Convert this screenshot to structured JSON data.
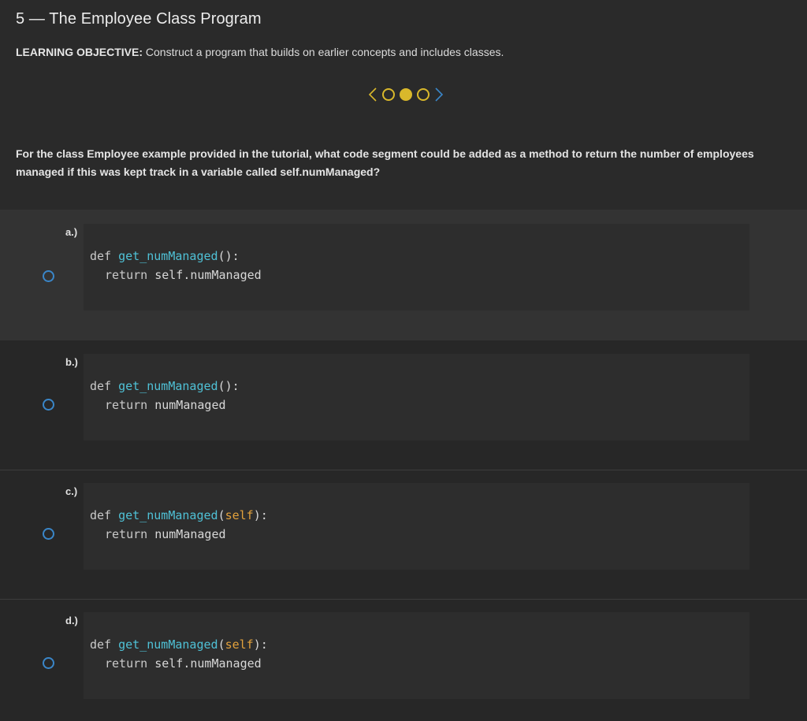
{
  "page": {
    "title": "5 — The Employee Class Program",
    "objective_label": "LEARNING OBJECTIVE:",
    "objective_text": " Construct a program that builds on earlier concepts and includes classes."
  },
  "pager": {
    "prev_icon": "chevron-left-icon",
    "next_icon": "chevron-right-icon",
    "dots": [
      "empty",
      "filled",
      "empty"
    ],
    "current": 2,
    "total": 3
  },
  "question": {
    "text": "For the class Employee example provided in the tutorial, what code segment could be added as a method to return the number of employees managed if this was kept track in a variable called self.numManaged?"
  },
  "options": [
    {
      "letter": "a.)",
      "line1": {
        "def": "def",
        "fn": "get_numManaged",
        "open": "(",
        "param": "",
        "close": "):"
      },
      "line2": {
        "kw": "return",
        "rest": " self.numManaged"
      }
    },
    {
      "letter": "b.)",
      "line1": {
        "def": "def",
        "fn": "get_numManaged",
        "open": "(",
        "param": "",
        "close": "):"
      },
      "line2": {
        "kw": "return",
        "rest": " numManaged"
      }
    },
    {
      "letter": "c.)",
      "line1": {
        "def": "def",
        "fn": "get_numManaged",
        "open": "(",
        "param": "self",
        "close": "):"
      },
      "line2": {
        "kw": "return",
        "rest": " numManaged"
      }
    },
    {
      "letter": "d.)",
      "line1": {
        "def": "def",
        "fn": "get_numManaged",
        "open": "(",
        "param": "self",
        "close": "):"
      },
      "line2": {
        "kw": "return",
        "rest": " self.numManaged"
      }
    }
  ],
  "colors": {
    "accent_dot": "#d9b82b",
    "radio": "#3a86c8",
    "function_name": "#4fc1d6",
    "self_param": "#e2a13c",
    "background": "#272727"
  }
}
